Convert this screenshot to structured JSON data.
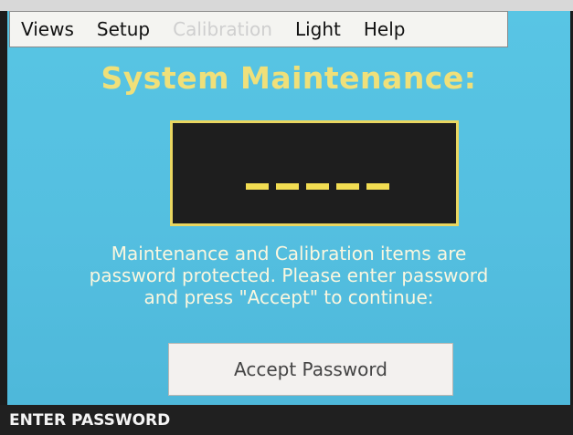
{
  "menu": {
    "views": "Views",
    "setup": "Setup",
    "calibration": "Calibration",
    "light": "Light",
    "help": "Help"
  },
  "title": "System Maintenance:",
  "password_field": {
    "masked_value": "-----"
  },
  "message": {
    "line1": "Maintenance and Calibration items are",
    "line2": "password protected.  Please enter password",
    "line3": "and press \"Accept\" to continue:"
  },
  "accept_button": "Accept Password",
  "status_bar": "ENTER PASSWORD",
  "colors": {
    "screen_background": "#58c5e4",
    "title_color": "#efe07a",
    "password_border": "#e9d660",
    "password_dash": "#f2dd52"
  }
}
